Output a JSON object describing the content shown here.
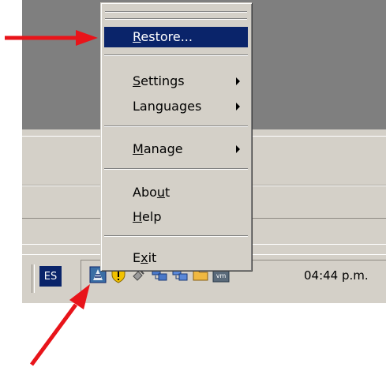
{
  "menu": {
    "items": [
      {
        "pre": "",
        "key": "R",
        "post": "estore...",
        "submenu": false,
        "selected": true
      },
      {
        "pre": "",
        "key": "S",
        "post": "ettings",
        "submenu": true,
        "selected": false
      },
      {
        "pre": "",
        "key": "",
        "post": "Languages",
        "submenu": true,
        "selected": false
      },
      {
        "pre": "",
        "key": "M",
        "post": "anage",
        "submenu": true,
        "selected": false
      },
      {
        "pre": "Abo",
        "key": "u",
        "post": "t",
        "submenu": false,
        "selected": false
      },
      {
        "pre": "",
        "key": "H",
        "post": "elp",
        "submenu": false,
        "selected": false
      },
      {
        "pre": "E",
        "key": "x",
        "post": "it",
        "submenu": false,
        "selected": false
      }
    ]
  },
  "taskbar": {
    "language": "ES",
    "clock": "04:44 p.m.",
    "tray_icons": [
      "network-status-icon",
      "security-shield-icon",
      "satellite-icon",
      "connected-computers-icon",
      "connected-computers-icon",
      "folder-icon",
      "vmware-icon"
    ]
  },
  "annotations": {
    "arrow_color": "#e8141a"
  },
  "colors": {
    "selection": "#0a246a",
    "face": "#d4d0c8",
    "desktop": "#7f7f7f"
  }
}
